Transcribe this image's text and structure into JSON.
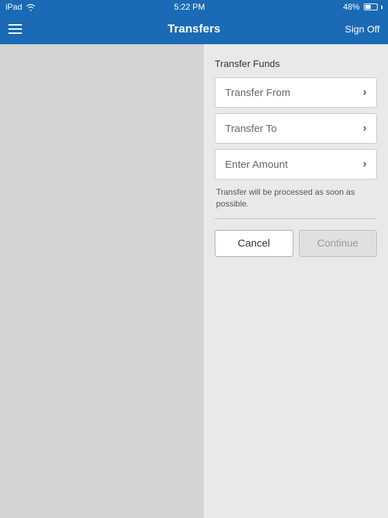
{
  "statusBar": {
    "device": "iPad",
    "signal": "wifi",
    "time": "5:22 PM",
    "battery_percent": "48%"
  },
  "navBar": {
    "menu_icon": "menu-icon",
    "title": "Transfers",
    "signoff_label": "Sign Off"
  },
  "form": {
    "section_title": "Transfer Funds",
    "transfer_from_label": "Transfer From",
    "transfer_to_label": "Transfer To",
    "enter_amount_label": "Enter Amount",
    "info_text": "Transfer will be processed as soon as possible.",
    "cancel_label": "Cancel",
    "continue_label": "Continue"
  }
}
